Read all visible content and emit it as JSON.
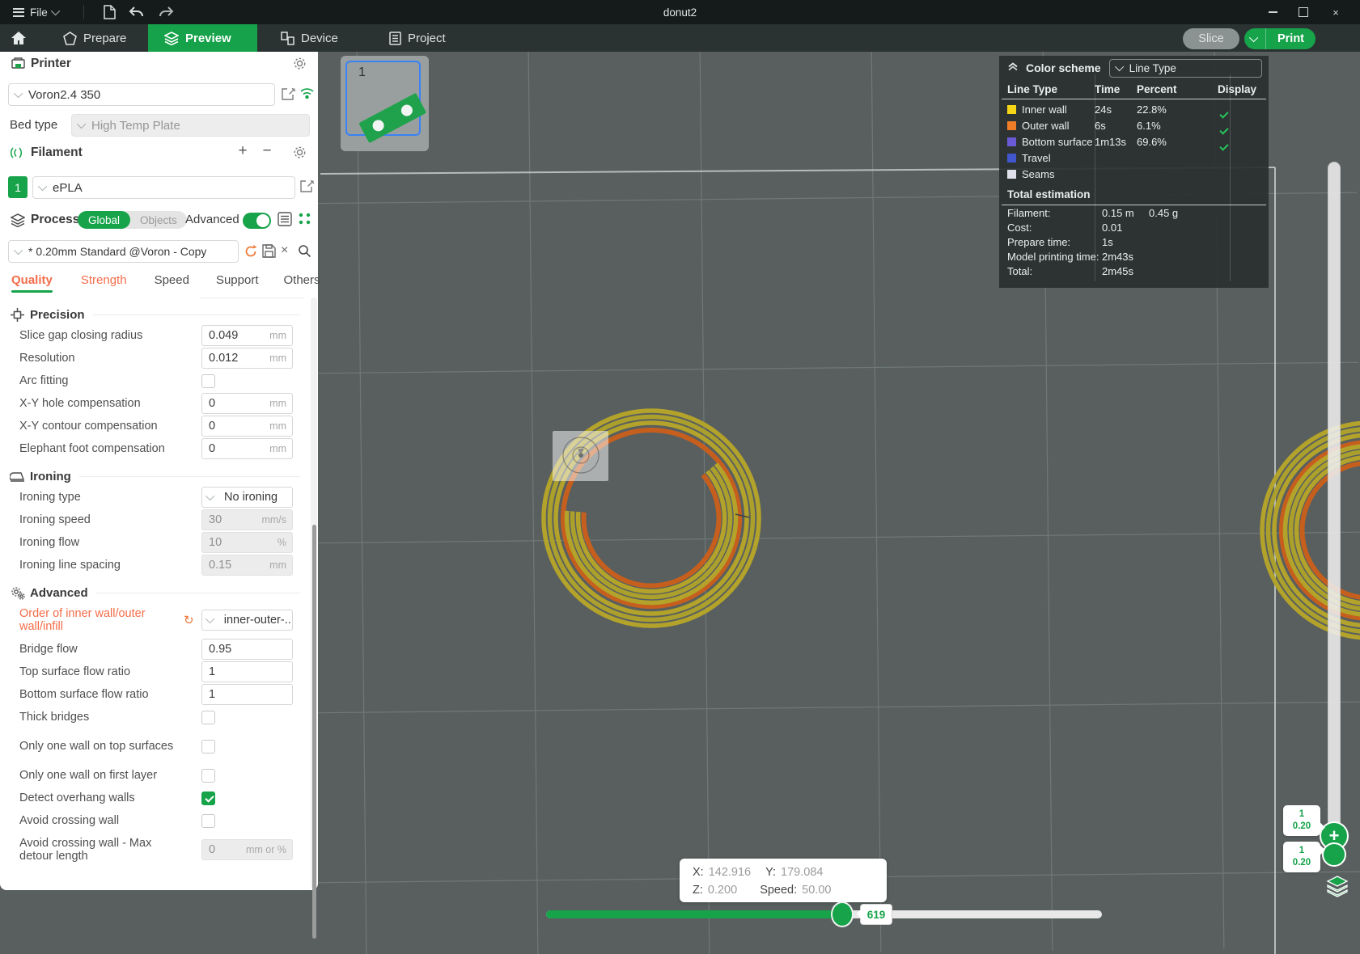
{
  "titlebar": {
    "title": "donut2",
    "menu_label": "File"
  },
  "tabbar": {
    "tabs": [
      {
        "label": "Prepare",
        "active": false
      },
      {
        "label": "Preview",
        "active": true
      },
      {
        "label": "Device",
        "active": false
      },
      {
        "label": "Project",
        "active": false
      }
    ],
    "slice_label": "Slice",
    "print_label": "Print"
  },
  "printer": {
    "header": "Printer",
    "name": "Voron2.4 350",
    "bed_type_label": "Bed type",
    "bed_type_value": "High Temp Plate"
  },
  "filament": {
    "header": "Filament",
    "slot": "1",
    "name": "ePLA"
  },
  "process": {
    "header": "Process",
    "scope_on": "Global",
    "scope_off": "Objects",
    "advanced_label": "Advanced",
    "preset": "* 0.20mm Standard @Voron - Copy"
  },
  "setting_tabs": [
    {
      "label": "Quality",
      "state": "selected-modified"
    },
    {
      "label": "Strength",
      "state": "modified"
    },
    {
      "label": "Speed",
      "state": "plain"
    },
    {
      "label": "Support",
      "state": "plain"
    },
    {
      "label": "Others",
      "state": "plain"
    }
  ],
  "sections": [
    {
      "title": "Precision",
      "icon": "precision-icon",
      "rows": [
        {
          "type": "input",
          "label": "Slice gap closing radius",
          "value": "0.049",
          "unit": "mm",
          "disabled": false
        },
        {
          "type": "input",
          "label": "Resolution",
          "value": "0.012",
          "unit": "mm",
          "disabled": false
        },
        {
          "type": "checkbox",
          "label": "Arc fitting",
          "checked": false
        },
        {
          "type": "input",
          "label": "X-Y hole compensation",
          "value": "0",
          "unit": "mm",
          "disabled": false
        },
        {
          "type": "input",
          "label": "X-Y contour compensation",
          "value": "0",
          "unit": "mm",
          "disabled": false
        },
        {
          "type": "input",
          "label": "Elephant foot compensation",
          "value": "0",
          "unit": "mm",
          "disabled": false
        }
      ]
    },
    {
      "title": "Ironing",
      "icon": "ironing-icon",
      "rows": [
        {
          "type": "select",
          "label": "Ironing type",
          "value": "No ironing"
        },
        {
          "type": "input",
          "label": "Ironing speed",
          "value": "30",
          "unit": "mm/s",
          "disabled": true
        },
        {
          "type": "input",
          "label": "Ironing flow",
          "value": "10",
          "unit": "%",
          "disabled": true
        },
        {
          "type": "input",
          "label": "Ironing line spacing",
          "value": "0.15",
          "unit": "mm",
          "disabled": true
        }
      ]
    },
    {
      "title": "Advanced",
      "icon": "advanced-icon",
      "rows": [
        {
          "type": "select",
          "label": "Order of inner wall/outer wall/infill",
          "value": "inner-outer-...",
          "modified": true,
          "two_line": true
        },
        {
          "type": "input",
          "label": "Bridge flow",
          "value": "0.95",
          "unit": "",
          "disabled": false
        },
        {
          "type": "input",
          "label": "Top surface flow ratio",
          "value": "1",
          "unit": "",
          "disabled": false
        },
        {
          "type": "input",
          "label": "Bottom surface flow ratio",
          "value": "1",
          "unit": "",
          "disabled": false
        },
        {
          "type": "checkbox",
          "label": "Thick bridges",
          "checked": false
        },
        {
          "type": "checkbox",
          "label": "Only one wall on top surfaces",
          "checked": false,
          "two_line": true
        },
        {
          "type": "checkbox",
          "label": "Only one wall on first layer",
          "checked": false
        },
        {
          "type": "checkbox",
          "label": "Detect overhang walls",
          "checked": true
        },
        {
          "type": "checkbox",
          "label": "Avoid crossing wall",
          "checked": false
        },
        {
          "type": "input",
          "label": "Avoid crossing wall - Max detour length",
          "value": "0",
          "unit": "mm or %",
          "disabled": true,
          "two_line": true
        }
      ]
    }
  ],
  "legend": {
    "title": "Color scheme",
    "scheme": "Line Type",
    "columns": [
      "Line Type",
      "Time",
      "Percent",
      "Display"
    ],
    "rows": [
      {
        "name": "Inner wall",
        "color": "#f5d617",
        "time": "24s",
        "percent": "22.8%",
        "display": true
      },
      {
        "name": "Outer wall",
        "color": "#ef7d28",
        "time": "6s",
        "percent": "6.1%",
        "display": true
      },
      {
        "name": "Bottom surface",
        "color": "#6a5ad6",
        "time": "1m13s",
        "percent": "69.6%",
        "display": true
      },
      {
        "name": "Travel",
        "color": "#4156cf",
        "time": "",
        "percent": "",
        "display": false
      },
      {
        "name": "Seams",
        "color": "#dfe0ea",
        "time": "",
        "percent": "",
        "display": false
      }
    ]
  },
  "estimation": {
    "title": "Total estimation",
    "rows": [
      {
        "label": "Filament:",
        "value": "0.15 m",
        "value2": "0.45 g"
      },
      {
        "label": "Cost:",
        "value": "0.01",
        "value2": ""
      },
      {
        "label": "Prepare time:",
        "value": "1s",
        "value2": ""
      },
      {
        "label": "Model printing time:",
        "value": "2m43s",
        "value2": ""
      },
      {
        "label": "Total:",
        "value": "2m45s",
        "value2": ""
      }
    ]
  },
  "viewport": {
    "plate_number": "1",
    "tooltip": {
      "x_label": "X:",
      "x": "142.916",
      "y_label": "Y:",
      "y": "179.084",
      "z_label": "Z:",
      "z": "0.200",
      "speed_label": "Speed:",
      "speed": "50.00"
    },
    "move_slider_value": "619",
    "layer_badges": [
      {
        "layer": "1",
        "height": "0.20"
      },
      {
        "layer": "1",
        "height": "0.20"
      }
    ]
  },
  "colors": {
    "accent_green": "#16a34a",
    "modified_orange": "#f46c49",
    "toolpath_inner_wall": "#b3a32a",
    "toolpath_outer_wall": "#c65f1d",
    "viewport_bg": "#595f5f"
  }
}
